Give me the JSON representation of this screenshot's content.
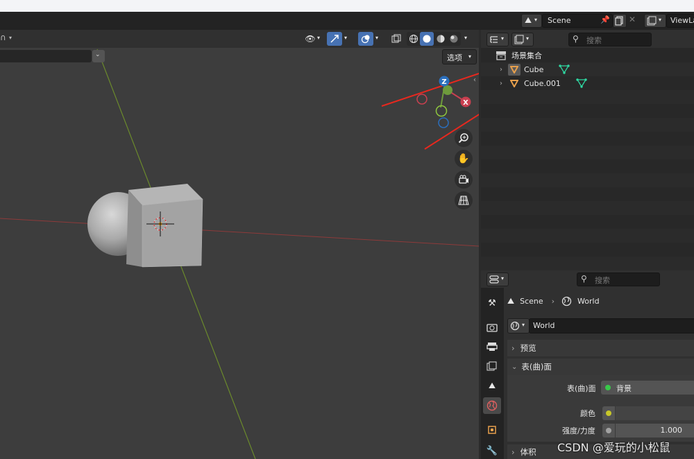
{
  "topbar": {
    "scene_name": "Scene",
    "view_layer": "ViewLa"
  },
  "viewport": {
    "options_label": "选项",
    "gizmo": {
      "z": "Z",
      "x": "X"
    }
  },
  "outliner": {
    "search_placeholder": "搜索",
    "collection": "场景集合",
    "items": [
      {
        "name": "Cube"
      },
      {
        "name": "Cube.001"
      }
    ]
  },
  "properties": {
    "search_placeholder": "搜索",
    "breadcrumb": {
      "scene": "Scene",
      "world": "World"
    },
    "world_name": "World",
    "sections": {
      "preview": "预览",
      "surface": "表(曲)面",
      "volume": "体积"
    },
    "fields": {
      "surface_label": "表(曲)面",
      "surface_value": "背景",
      "color_label": "颜色",
      "strength_label": "强度/力度",
      "strength_value": "1.000"
    }
  },
  "watermark": "CSDN @爱玩的小松鼠",
  "colors": {
    "accent_blue": "#4772b3",
    "mesh_orange": "#e8a04c",
    "arrow_red": "#e8281e",
    "vertex_green": "#2fd8a2"
  }
}
